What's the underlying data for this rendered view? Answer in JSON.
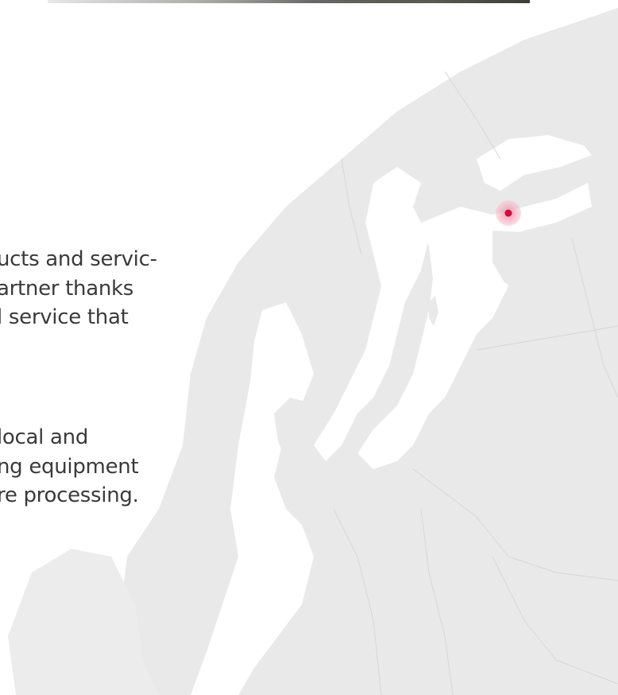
{
  "paragraph_1": {
    "lines": [
      "ucts and servic-",
      "artner thanks",
      "l service that"
    ]
  },
  "paragraph_2": {
    "lines": [
      "local and",
      "ng equipment",
      "re processing."
    ]
  },
  "map": {
    "background_color": "#ececec",
    "land_color": "#e9e9e9",
    "sea_color": "#ffffff",
    "border_color": "#d6d6d6",
    "marker_color": "#cf0a3c",
    "marker_halo_color": "#f2b3c2"
  }
}
